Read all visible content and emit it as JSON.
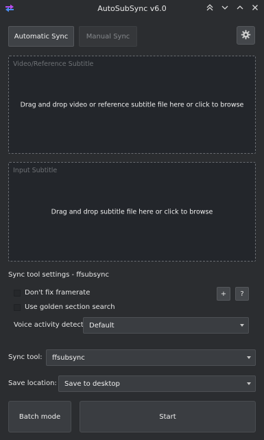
{
  "window": {
    "title": "AutoSubSync v6.0",
    "app_icon": "sync-arrows-icon",
    "controls": [
      "keep-above-icon",
      "minimize-icon",
      "maximize-icon"
    ]
  },
  "tabs": {
    "automatic": "Automatic Sync",
    "manual": "Manual Sync",
    "active": "automatic"
  },
  "settings_icon": "gear-icon",
  "video_drop": {
    "label": "Video/Reference Subtitle",
    "text": "Drag and drop video or reference subtitle file here or click to browse"
  },
  "input_drop": {
    "label": "Input Subtitle",
    "text": "Drag and drop subtitle file here or click to browse"
  },
  "sync_settings": {
    "title": "Sync tool settings - ffsubsync",
    "dont_fix_framerate": {
      "label": "Don't fix framerate",
      "checked": false
    },
    "golden_section": {
      "label": "Use golden section search",
      "checked": false
    },
    "plus_label": "+",
    "help_label": "?",
    "vad_label": "Voice activity detector",
    "vad_value": "Default"
  },
  "sync_tool": {
    "label": "Sync tool:",
    "value": "ffsubsync"
  },
  "save_location": {
    "label": "Save location:",
    "value": "Save to desktop"
  },
  "actions": {
    "batch_mode": "Batch mode",
    "start": "Start"
  },
  "colors": {
    "background": "#2b2d30",
    "dropzone_bg": "#23262b",
    "accent": "#b84df0"
  }
}
